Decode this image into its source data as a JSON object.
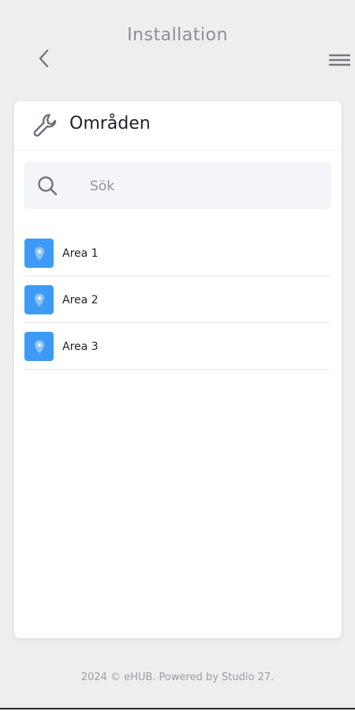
{
  "header": {
    "title": "Installation",
    "back_icon": "chevron-left-icon",
    "menu_icon": "hamburger-menu-icon"
  },
  "card": {
    "title": "Områden",
    "title_icon": "wrench-icon"
  },
  "search": {
    "placeholder": "Sök",
    "value": ""
  },
  "areas": [
    {
      "label": "Area 1",
      "icon": "map-pin-icon"
    },
    {
      "label": "Area 2",
      "icon": "map-pin-icon"
    },
    {
      "label": "Area 3",
      "icon": "map-pin-icon"
    }
  ],
  "footer": {
    "text": "2024 © eHUB. Powered by Studio 27."
  },
  "colors": {
    "background": "#eeeeef",
    "accent": "#3d9af5",
    "header_text": "#8c8f95"
  }
}
